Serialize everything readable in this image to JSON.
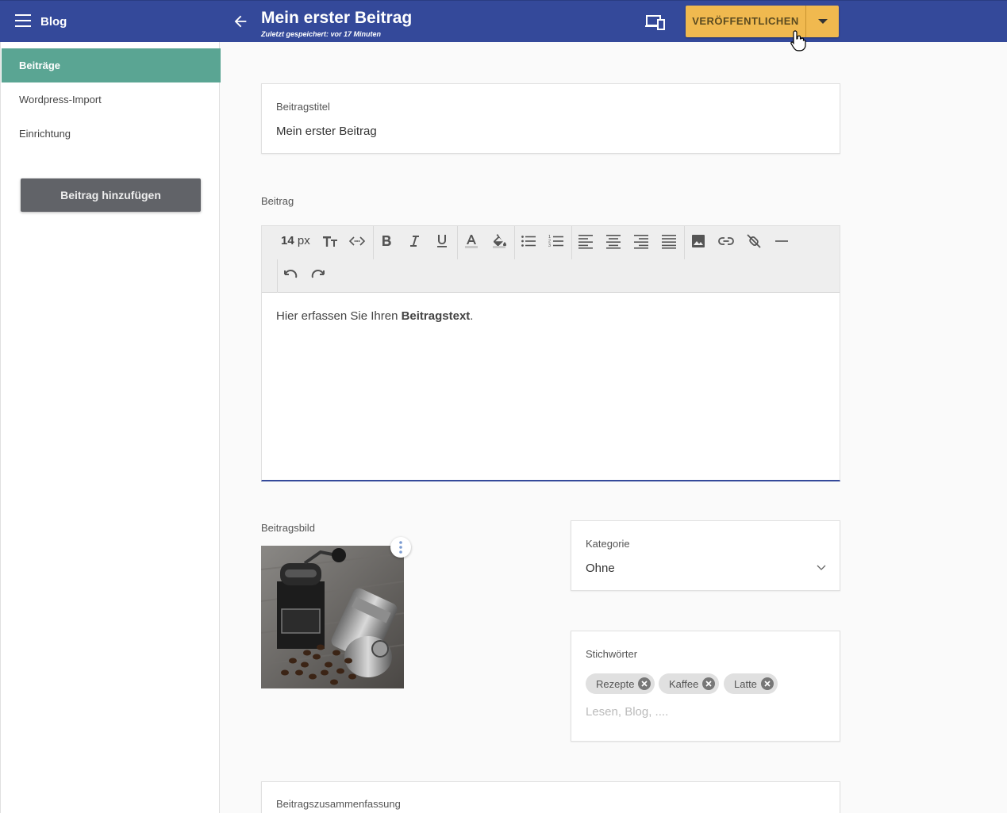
{
  "header": {
    "app_title": "Blog",
    "post_title": "Mein erster Beitrag",
    "saved_status": "Zuletzt gespeichert: vor 17 Minuten",
    "publish_label": "VERÖFFENTLICHEN",
    "colors": {
      "bar": "#34499a",
      "publish": "#f0b94f"
    }
  },
  "sidebar": {
    "items": [
      {
        "label": "Beiträge",
        "active": true
      },
      {
        "label": "Wordpress-Import",
        "active": false
      },
      {
        "label": "Einrichtung",
        "active": false
      }
    ],
    "add_button": "Beitrag hinzufügen",
    "accent": "#5aa593"
  },
  "form": {
    "title_label": "Beitragstitel",
    "title_value": "Mein erster Beitrag",
    "body_label": "Beitrag",
    "font_size": {
      "value": "14",
      "unit": "px"
    },
    "body_text_plain": "Hier erfassen Sie Ihren ",
    "body_text_bold": "Beitragstext",
    "body_text_end": ".",
    "image_label": "Beitragsbild",
    "category_label": "Kategorie",
    "category_value": "Ohne",
    "tags_label": "Stichwörter",
    "tags": [
      "Rezepte",
      "Kaffee",
      "Latte"
    ],
    "tags_placeholder": "Lesen, Blog, ....",
    "summary_label": "Beitragszusammenfassung"
  },
  "toolbar_icons": [
    "font-size",
    "text-size-icon",
    "code-icon",
    "bold-icon",
    "italic-icon",
    "underline-icon",
    "font-color-icon",
    "fill-color-icon",
    "bullet-list-icon",
    "numbered-list-icon",
    "align-left-icon",
    "align-center-icon",
    "align-right-icon",
    "align-justify-icon",
    "image-icon",
    "link-icon",
    "unlink-icon",
    "horizontal-rule-icon",
    "undo-icon",
    "redo-icon"
  ]
}
